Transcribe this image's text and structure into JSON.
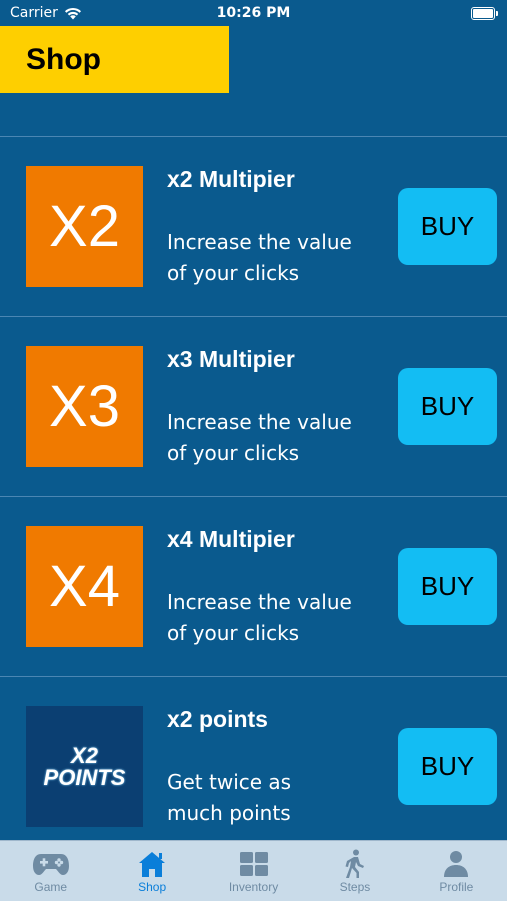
{
  "status_bar": {
    "carrier": "Carrier",
    "time": "10:26 PM"
  },
  "header": {
    "title": "Shop"
  },
  "items": [
    {
      "thumb_text": "X2",
      "title": "x2 Multipier",
      "desc_line1": "Increase the value",
      "desc_line2": "of your clicks",
      "buy_label": "BUY"
    },
    {
      "thumb_text": "X3",
      "title": "x3 Multipier",
      "desc_line1": "Increase the value",
      "desc_line2": "of your clicks",
      "buy_label": "BUY"
    },
    {
      "thumb_text": "X4",
      "title": "x4 Multipier",
      "desc_line1": "Increase the value",
      "desc_line2": "of your clicks",
      "buy_label": "BUY"
    },
    {
      "thumb_line1": "X2",
      "thumb_line2": "POINTS",
      "title": "x2 points",
      "desc_line1": "Get twice as",
      "desc_line2": "much points",
      "buy_label": "BUY"
    }
  ],
  "tabs": [
    {
      "label": "Game",
      "icon": "gamepad-icon",
      "active": false
    },
    {
      "label": "Shop",
      "icon": "shop-icon",
      "active": true
    },
    {
      "label": "Inventory",
      "icon": "grid-icon",
      "active": false
    },
    {
      "label": "Steps",
      "icon": "walking-icon",
      "active": false
    },
    {
      "label": "Profile",
      "icon": "person-icon",
      "active": false
    }
  ],
  "colors": {
    "background": "#0a5a8e",
    "header": "#fecf00",
    "thumb": "#f07a00",
    "buy_button": "#13bdf3",
    "tab_active": "#0a7ed9",
    "tab_inactive": "#6f8ba3"
  }
}
